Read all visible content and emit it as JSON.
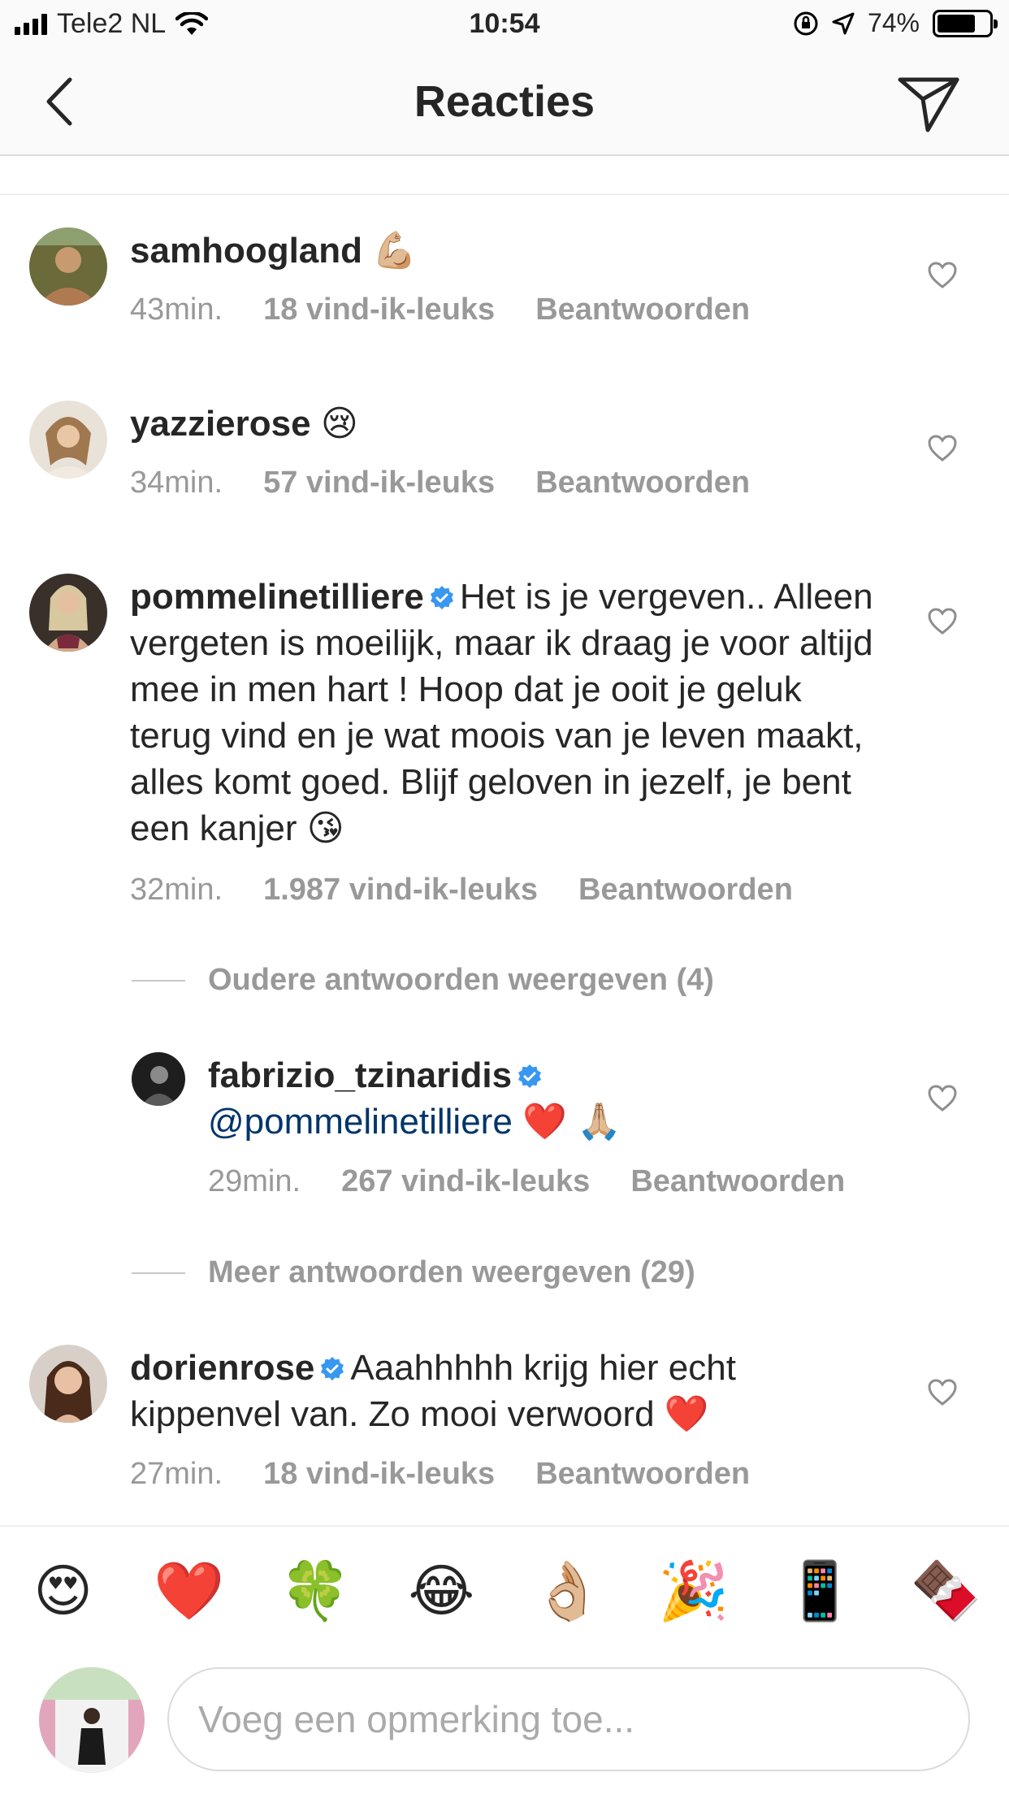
{
  "status_bar": {
    "carrier": "Tele2 NL",
    "time": "10:54",
    "battery": "74%",
    "battery_level": 0.74
  },
  "header": {
    "title": "Reacties",
    "back_icon": "chevron-left-icon",
    "send_icon": "paper-plane-icon"
  },
  "comments": [
    {
      "username": "samhoogland",
      "text": "💪🏼",
      "time": "43min.",
      "likes": "18 vind-ik-leuks",
      "reply": "Beantwoorden",
      "avatar_color": "#7a6a3a"
    },
    {
      "username": "yazzierose",
      "text": "😢",
      "time": "34min.",
      "likes": "57 vind-ik-leuks",
      "reply": "Beantwoorden",
      "avatar_color": "#cdb9a0"
    },
    {
      "username": "pommelinetilliere",
      "text": "Het is je vergeven.. Alleen vergeten is moeilijk, maar ik draag je voor altijd mee in men hart ! Hoop dat je ooit je geluk terug vind en je wat moois van je leven maakt, alles komt goed. Blijf geloven in jezelf, je bent een kanjer 😘",
      "time": "32min.",
      "likes": "1.987 vind-ik-leuks",
      "reply": "Beantwoorden",
      "avatar_color": "#5a4a42"
    },
    {
      "username": "dorienrose",
      "text": "Aaahhhhh krijg hier echt kippenvel van. Zo mooi verwoord ❤️",
      "time": "27min.",
      "likes": "18 vind-ik-leuks",
      "reply": "Beantwoorden",
      "avatar_color": "#6b4a3a"
    }
  ],
  "older_replies": "Oudere antwoorden weergeven (4)",
  "reply": {
    "username": "fabrizio_tzinaridis",
    "mention": "@pommelinetilliere",
    "text": "❤️ 🙏🏼",
    "time": "29min.",
    "likes": "267 vind-ik-leuks",
    "reply": "Beantwoorden",
    "avatar_color": "#2a2a2a"
  },
  "more_replies": "Meer antwoorden weergeven (29)",
  "emoji_bar": [
    "😍",
    "❤️",
    "🍀",
    "😂",
    "👌🏼",
    "🎉",
    "📱",
    "🍫"
  ],
  "composer": {
    "placeholder": "Voeg een opmerking toe...",
    "avatar_color": "#d68aa8"
  },
  "colors": {
    "text": "#262626",
    "meta": "#999999",
    "mention": "#003569",
    "verified": "#3897f0"
  }
}
